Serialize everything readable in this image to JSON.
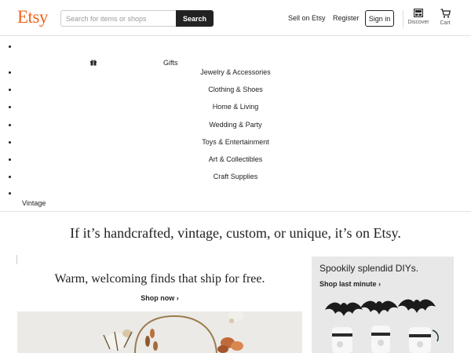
{
  "header": {
    "logo": "Etsy",
    "search_placeholder": "Search for items or shops",
    "search_button": "Search",
    "sell_link": "Sell on Etsy",
    "register_link": "Register",
    "signin_button": "Sign in",
    "discover_label": "Discover",
    "cart_label": "Cart"
  },
  "categories": {
    "gifts": "Gifts",
    "items": [
      "Jewelry & Accessories",
      "Clothing & Shoes",
      "Home & Living",
      "Wedding & Party",
      "Toys & Entertainment",
      "Art & Collectibles",
      "Craft Supplies"
    ],
    "vintage": "Vintage"
  },
  "hero": {
    "tagline": "If it’s handcrafted, vintage, custom, or unique, it’s on Etsy."
  },
  "promo_left": {
    "title": "Warm, welcoming finds that ship for free.",
    "link": "Shop now ›"
  },
  "promo_right": {
    "title": "Spookily splendid DIYs.",
    "link": "Shop last minute ›"
  },
  "colors": {
    "brand": "#f1641e",
    "button_dark": "#222222",
    "card_bg": "#e8e8e8"
  }
}
